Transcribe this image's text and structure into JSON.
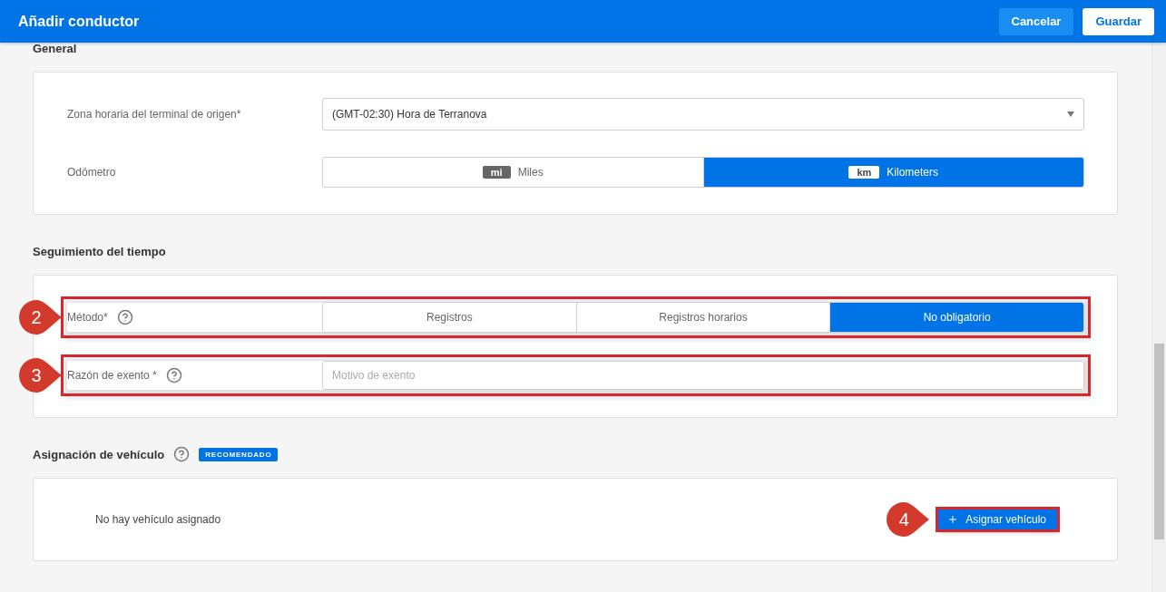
{
  "header": {
    "title": "Añadir conductor",
    "buttons": [
      {
        "label": "Cancelar",
        "kind": "secondary"
      },
      {
        "label": "Guardar",
        "kind": "primary"
      }
    ]
  },
  "sections": [
    {
      "heading": "General",
      "rows": [
        {
          "kind": "select",
          "label": "Zona horaria del terminal de origen*",
          "value": "(GMT-02:30) Hora de Terranova"
        },
        {
          "kind": "toggle",
          "label": "Odómetro",
          "options": [
            {
              "badge": "mi",
              "label": "Miles",
              "selected": false
            },
            {
              "badge": "km",
              "label": "Kilometers",
              "selected": true
            }
          ]
        }
      ]
    },
    {
      "heading": "Seguimiento del tiempo",
      "rows": [
        {
          "kind": "segmented",
          "label": "Método*",
          "help": true,
          "callout": "2",
          "options": [
            {
              "label": "Registros",
              "selected": false
            },
            {
              "label": "Registros horarios",
              "selected": false
            },
            {
              "label": "No obligatorio",
              "selected": true
            }
          ]
        },
        {
          "kind": "text",
          "label": "Razón de exento *",
          "help": true,
          "callout": "3",
          "placeholder": "Motivo de exento"
        }
      ]
    },
    {
      "heading": "Asignación de vehículo",
      "help": true,
      "tag": "RECOMENDADO",
      "empty_text": "No hay vehículo asignado",
      "action": {
        "label": "Asignar vehículo",
        "callout": "4"
      }
    }
  ]
}
